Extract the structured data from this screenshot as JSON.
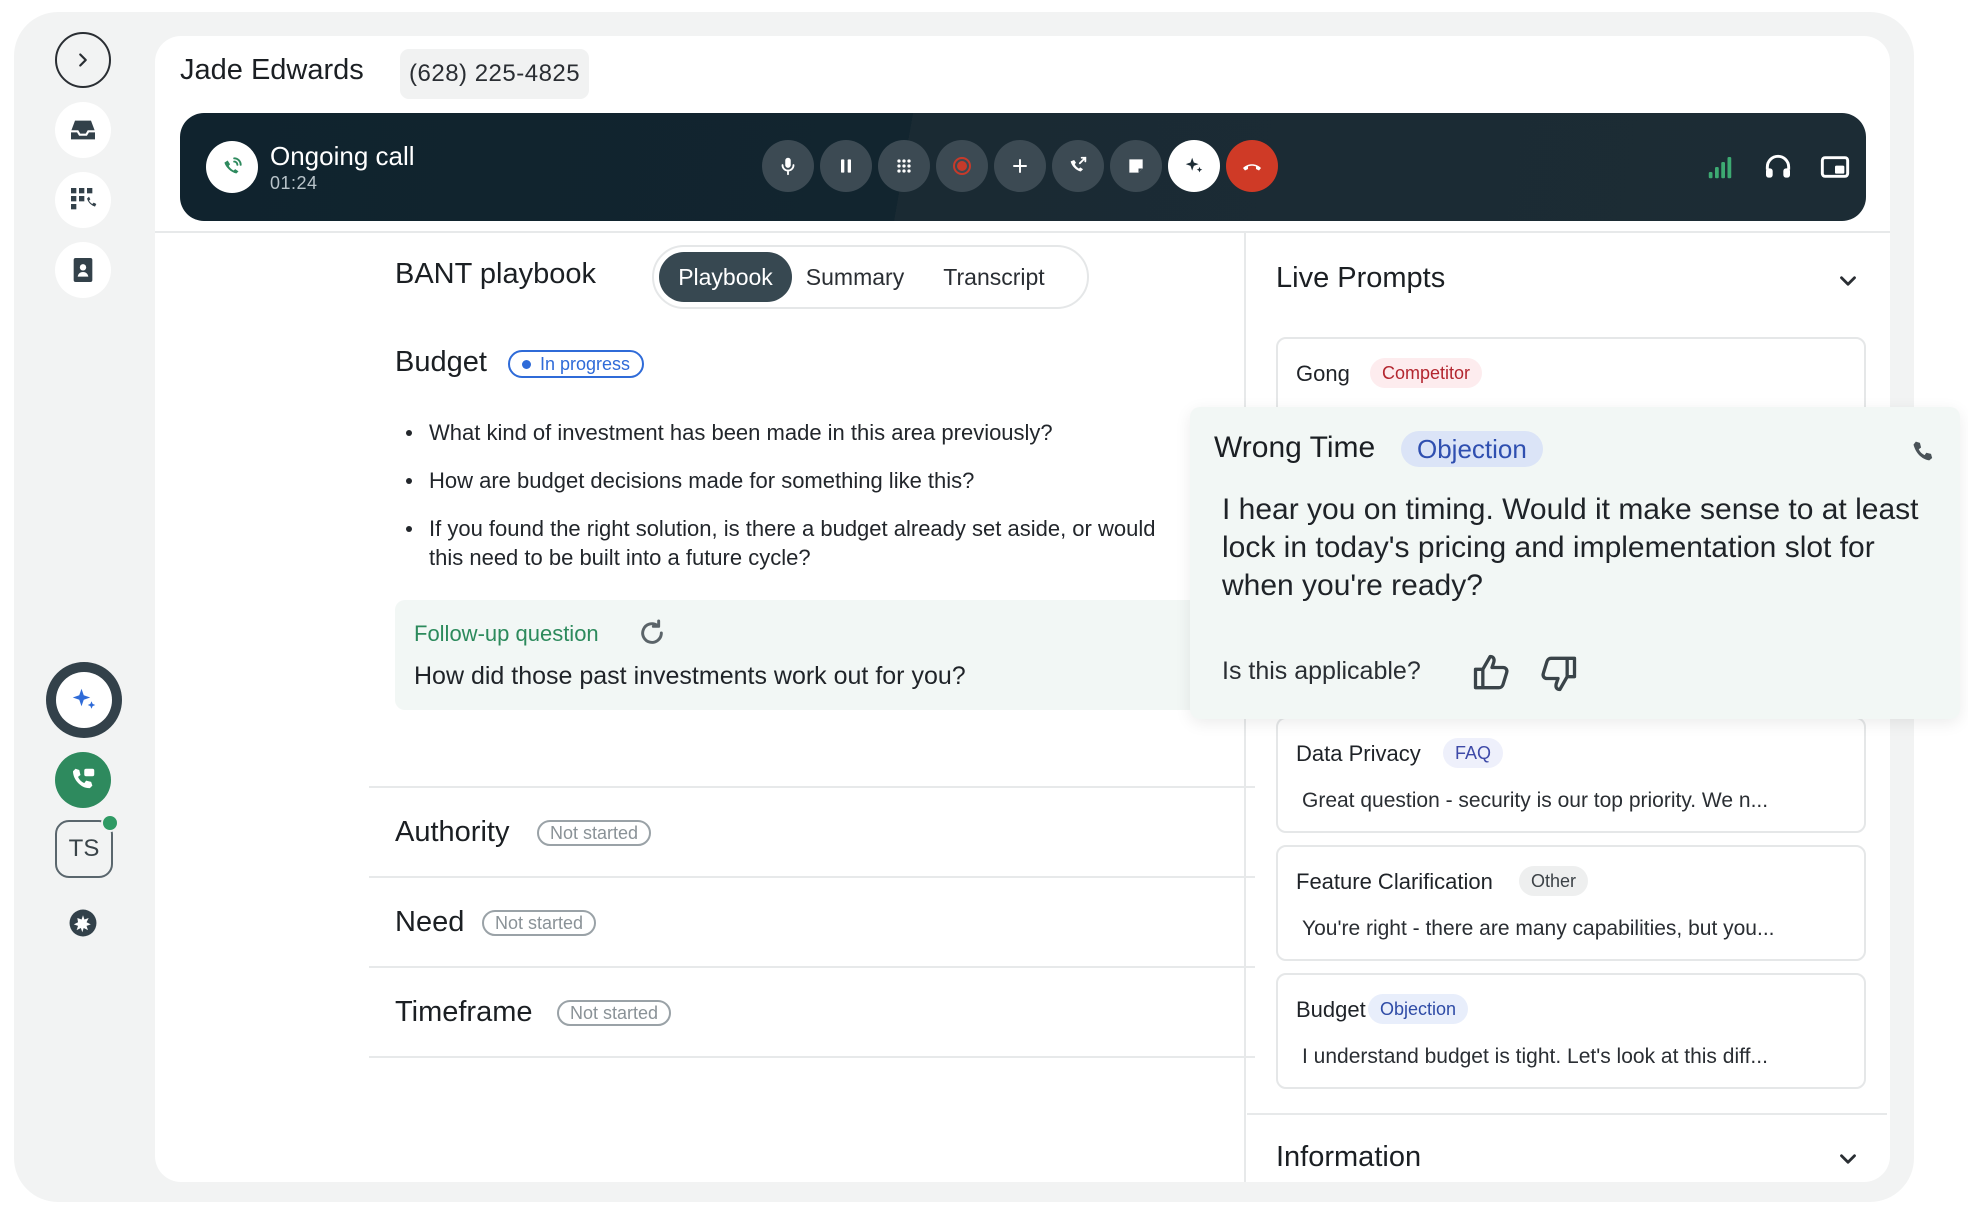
{
  "contact": {
    "name": "Jade Edwards",
    "phone": "(628) 225-4825"
  },
  "call": {
    "status": "Ongoing call",
    "duration": "01:24",
    "controls": [
      "mic",
      "pause",
      "keypad",
      "record",
      "add",
      "transfer",
      "notes",
      "ai-assist",
      "hang-up"
    ]
  },
  "playbook": {
    "title": "BANT playbook",
    "tabs": [
      {
        "label": "Playbook",
        "active": true
      },
      {
        "label": "Summary"
      },
      {
        "label": "Transcript"
      }
    ],
    "sections": [
      {
        "title": "Budget",
        "status": "In progress"
      },
      {
        "title": "Authority",
        "status": "Not started"
      },
      {
        "title": "Need",
        "status": "Not started"
      },
      {
        "title": "Timeframe",
        "status": "Not started"
      }
    ],
    "budget_questions": [
      "What kind of investment has been made in this area previously?",
      "How are budget decisions made for something like this?",
      "If you found the right solution, is there a budget already set aside, or would this need to be built into a future cycle?"
    ],
    "followup": {
      "label": "Follow-up question",
      "text": "How did those past investments work out for you?"
    }
  },
  "live_prompts": {
    "title": "Live Prompts",
    "cards": [
      {
        "title": "Gong",
        "tag": "Competitor",
        "tag_color": "#b3262f",
        "body": ""
      },
      {
        "title": "Data Privacy",
        "tag": "FAQ",
        "tag_color": "#3e4aa8",
        "body": "Great question - security is our top priority. We n..."
      },
      {
        "title": "Feature Clarification",
        "tag": "Other",
        "tag_color": "#3c4247",
        "body": "You're right - there are many capabilities, but you..."
      },
      {
        "title": "Budget",
        "tag": "Objection",
        "tag_color": "#2e4ba6",
        "body": "I understand budget is tight. Let's look at this diff..."
      }
    ],
    "expanded": {
      "title": "Wrong Time",
      "tag": "Objection",
      "body": "I hear you on timing. Would it make sense to at least lock in today's pricing and implementation slot for when you're ready?",
      "feedback_question": "Is this applicable?"
    }
  },
  "information": {
    "title": "Information"
  },
  "user": {
    "initials": "TS",
    "online": true
  },
  "colors": {
    "accent_green": "#2c8a5c",
    "call_bar": "#12252f",
    "hangup": "#cf3a26",
    "progress_blue": "#2f6bd8"
  }
}
